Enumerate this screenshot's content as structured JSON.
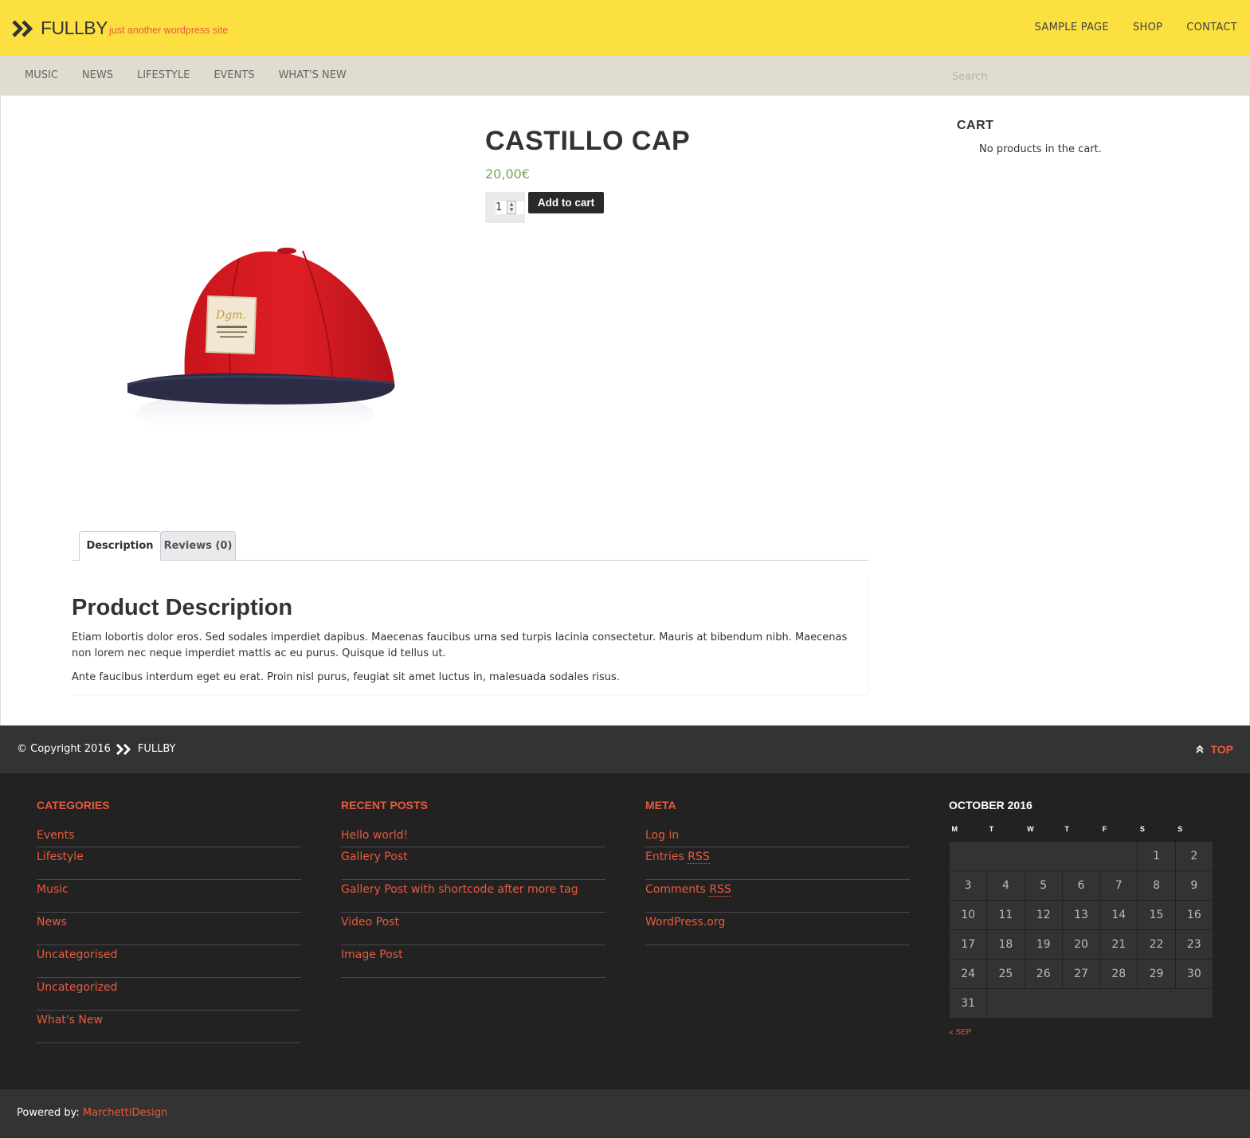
{
  "site": {
    "name": "FULLBY",
    "tagline": "just another wordpress site"
  },
  "topnav": [
    "SAMPLE PAGE",
    "SHOP",
    "CONTACT"
  ],
  "catnav": [
    "MUSIC",
    "NEWS",
    "LIFESTYLE",
    "EVENTS",
    "WHAT'S NEW"
  ],
  "search": {
    "placeholder": "Search"
  },
  "product": {
    "title": "CASTILLO CAP",
    "price": "20,00€",
    "quantity": "1",
    "add_to_cart": "Add to cart",
    "image_label": "Dgm."
  },
  "cart": {
    "title": "CART",
    "empty_text": "No products in the cart."
  },
  "tabs": {
    "description": "Description",
    "reviews": "Reviews (0)"
  },
  "description": {
    "heading": "Product Description",
    "p1": "Etiam lobortis dolor eros. Sed sodales imperdiet dapibus. Maecenas faucibus urna sed turpis lacinia consectetur. Mauris at bibendum nibh. Maecenas non lorem nec neque imperdiet mattis ac eu purus. Quisque id tellus ut.",
    "p2": "Ante faucibus interdum eget eu erat. Proin nisl purus, feugiat sit amet luctus in, malesuada sodales risus."
  },
  "footer": {
    "copyright": "© Copyright 2016",
    "brand": "FULLBY",
    "top": "TOP",
    "powered_label": "Powered by:",
    "powered_link": "MarchettiDesign"
  },
  "widgets": {
    "categories": {
      "title": "CATEGORIES",
      "items": [
        "Events",
        "Lifestyle",
        "Music",
        "News",
        "Uncategorised",
        "Uncategorized",
        "What's New"
      ]
    },
    "recent_posts": {
      "title": "RECENT POSTS",
      "items": [
        "Hello world!",
        "Gallery Post",
        "Gallery Post with shortcode after more tag",
        "Video Post",
        "Image Post"
      ]
    },
    "meta": {
      "title": "META",
      "items": [
        "Log in",
        "Entries",
        "Comments",
        "WordPress.org"
      ],
      "rss": "RSS"
    },
    "calendar": {
      "title": "OCTOBER 2016",
      "days": [
        "M",
        "T",
        "W",
        "T",
        "F",
        "S",
        "S"
      ],
      "weeks": [
        [
          "",
          "",
          "",
          "",
          "",
          "1",
          "2"
        ],
        [
          "3",
          "4",
          "5",
          "6",
          "7",
          "8",
          "9"
        ],
        [
          "10",
          "11",
          "12",
          "13",
          "14",
          "15",
          "16"
        ],
        [
          "17",
          "18",
          "19",
          "20",
          "21",
          "22",
          "23"
        ],
        [
          "24",
          "25",
          "26",
          "27",
          "28",
          "29",
          "30"
        ],
        [
          "31",
          "",
          "",
          "",
          "",
          "",
          ""
        ]
      ],
      "prev": "« SEP"
    }
  },
  "colors": {
    "topbar": "#fbe03f",
    "catbar": "#e0ddd0",
    "accent": "#e85a3f",
    "price": "#77a464",
    "footer_dark": "#222222",
    "footer_bar": "#333333"
  },
  "icons": {
    "logo": "double-chevron-right-icon",
    "top": "double-chevron-up-icon"
  }
}
